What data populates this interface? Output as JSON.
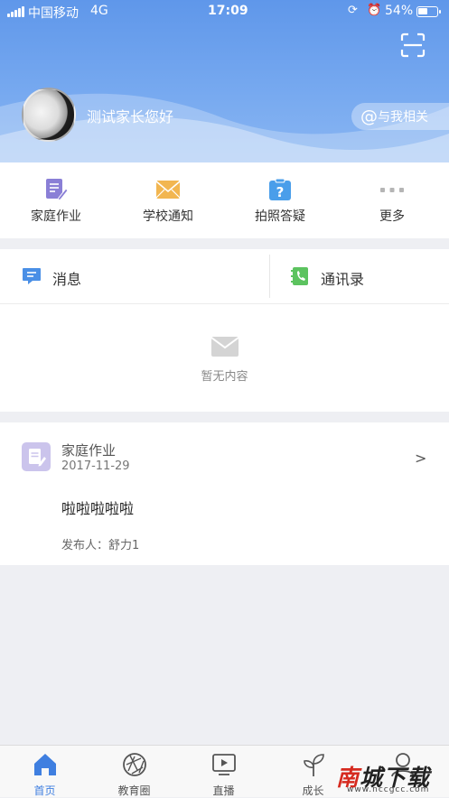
{
  "status_bar": {
    "carrier": "中国移动",
    "network": "4G",
    "time": "17:09",
    "battery_text": "54%",
    "battery_level": 0.54
  },
  "header": {
    "greeting": "测试家长您好",
    "related_label": "与我相关",
    "related_at": "@",
    "scan_icon": "scan-icon",
    "gradient_top": "#5f97ea",
    "gradient_bottom": "#8ab6f2"
  },
  "quick_actions": [
    {
      "label": "家庭作业",
      "icon": "homework-icon",
      "color": "#8a7fd6"
    },
    {
      "label": "学校通知",
      "icon": "envelope-icon",
      "color": "#f2b650"
    },
    {
      "label": "拍照答疑",
      "icon": "question-clipboard-icon",
      "color": "#4a9eea"
    },
    {
      "label": "更多",
      "icon": "more-dots-icon",
      "color": "#b5b5b5"
    }
  ],
  "messages": {
    "tab_messages": "消息",
    "tab_contacts": "通讯录",
    "empty_text": "暂无内容"
  },
  "homework_card": {
    "title": "家庭作业",
    "date": "2017-11-29",
    "arrow": ">",
    "content": "啦啦啦啦啦",
    "publisher": "发布人：舒力1"
  },
  "tabbar": {
    "items": [
      {
        "label": "首页",
        "icon": "home-icon",
        "active": true
      },
      {
        "label": "教育圈",
        "icon": "aperture-icon",
        "active": false
      },
      {
        "label": "直播",
        "icon": "play-screen-icon",
        "active": false
      },
      {
        "label": "成长",
        "icon": "sprout-icon",
        "active": false
      },
      {
        "label": "",
        "icon": "user-icon",
        "active": false
      }
    ],
    "active_color": "#3f7fe0"
  },
  "watermark": {
    "main_red": "南",
    "main_rest": "城下载",
    "sub": "www.nccgcc.com"
  }
}
